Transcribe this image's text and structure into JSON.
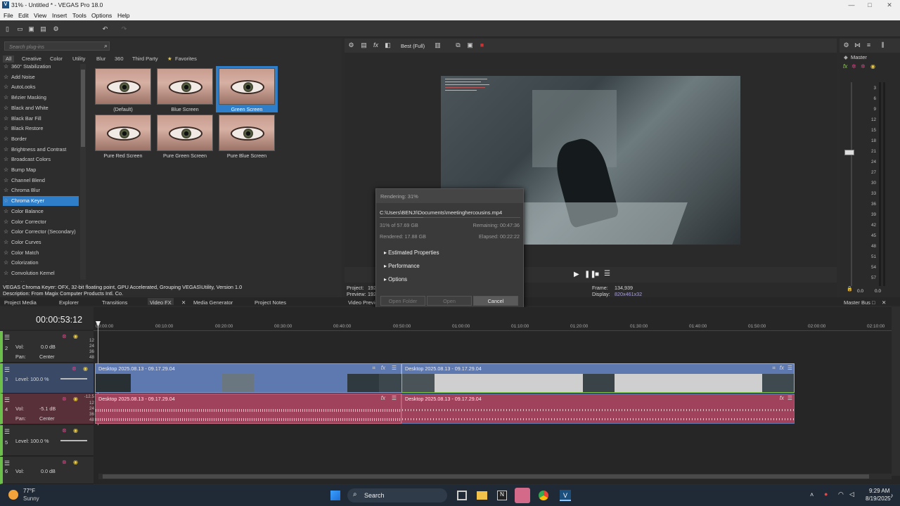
{
  "window": {
    "title": "31% - Untitled * - VEGAS Pro 18.0",
    "app_icon_letter": "V"
  },
  "menu": [
    "File",
    "Edit",
    "View",
    "Insert",
    "Tools",
    "Options",
    "Help"
  ],
  "plugins": {
    "search_placeholder": "Search plug-ins",
    "categories": [
      "All",
      "Creative",
      "Color",
      "Utility",
      "Blur",
      "360",
      "Third Party",
      "Favorites"
    ],
    "list": [
      "360° Stabilization",
      "Add Noise",
      "AutoLooks",
      "Bézier Masking",
      "Black and White",
      "Black Bar Fill",
      "Black Restore",
      "Border",
      "Brightness and Contrast",
      "Broadcast Colors",
      "Bump Map",
      "Channel Blend",
      "Chroma Blur",
      "Chroma Keyer",
      "Color Balance",
      "Color Corrector",
      "Color Corrector (Secondary)",
      "Color Curves",
      "Color Match",
      "Colorization",
      "Convolution Kernel",
      "Cookie Cutter"
    ],
    "selected": "Chroma Keyer",
    "presets": [
      "(Default)",
      "Blue Screen",
      "Green Screen",
      "Pure Red Screen",
      "Pure Green Screen",
      "Pure Blue Screen"
    ],
    "selected_preset": "Green Screen",
    "description_line1": "VEGAS Chroma Keyer: OFX, 32-bit floating point, GPU Accelerated, Grouping VEGAS\\Utility, Version 1.0",
    "description_line2": "Description: From Magix Computer Products Intl. Co."
  },
  "bottom_tabs": [
    "Project Media",
    "Explorer",
    "Transitions",
    "Video FX",
    "Media Generator",
    "Project Notes"
  ],
  "preview": {
    "quality": "Best (Full)",
    "project_label": "Project:",
    "project_value": "192",
    "preview_label": "Preview:",
    "preview_value": "192",
    "frame_label": "Frame:",
    "frame_value": "134,939",
    "display_label": "Display:",
    "display_value": "820x461x32",
    "tab": "Video Preview"
  },
  "master": {
    "label": "Master",
    "bus_tab": "Master Bus",
    "scale": [
      "3",
      "6",
      "9",
      "12",
      "15",
      "18",
      "21",
      "24",
      "27",
      "30",
      "33",
      "36",
      "39",
      "42",
      "45",
      "48",
      "51",
      "54",
      "57"
    ],
    "readout_left": "0.0",
    "readout_right": "0.0"
  },
  "render_dialog": {
    "header": "Rendering: 31%",
    "path": "C:\\Users\\BENJI\\Documents\\meetinghercousins.mp4",
    "progress_text": "31% of 57.69 GB",
    "remaining": "Remaining: 00:47:36",
    "rendered": "Rendered: 17.88 GB",
    "elapsed": "Elapsed: 00:22:22",
    "sections": [
      "Estimated Properties",
      "Performance",
      "Options"
    ],
    "open_folder": "Open Folder",
    "open": "Open",
    "cancel": "Cancel",
    "progress": 0.31
  },
  "timeline": {
    "timecode": "00:00:53:12",
    "ruler": [
      "00:00:00",
      "00:10:00",
      "00:20:00",
      "00:30:00",
      "00:40:00",
      "00:50:00",
      "01:00:00",
      "01:10:00",
      "01:20:00",
      "01:30:00",
      "01:40:00",
      "01:50:00",
      "02:00:00",
      "02:10:00"
    ],
    "tracks": [
      {
        "num": "2",
        "vol": "Vol:",
        "vol_value": "0.0 dB",
        "pan": "Pan:",
        "pan_value": "Center"
      },
      {
        "num": "3",
        "level": "Level: 100.0 %"
      },
      {
        "num": "4",
        "vol": "Vol:",
        "vol_value": "-5.1 dB",
        "pan": "Pan:",
        "pan_value": "Center"
      },
      {
        "num": "5",
        "level": "Level: 100.0 %"
      },
      {
        "num": "6",
        "vol": "Vol:",
        "vol_value": "0.0 dB"
      }
    ],
    "clip_name": "Desktop 2025.08.13 - 09.17.29.04",
    "meter_ticks": [
      "12",
      "24",
      "36",
      "48"
    ],
    "meter_ticks_audio": [
      "-12.5",
      "12",
      "24",
      "36",
      "48"
    ]
  },
  "taskbar": {
    "weather_temp": "77°F",
    "weather_desc": "Sunny",
    "search": "Search",
    "time": "9:29 AM",
    "date": "8/19/2025"
  },
  "colors": {
    "selection": "#2f7ec9",
    "video_track": "#5e78b0",
    "audio_track": "#a0425b",
    "accent_green": "#8fd14f"
  }
}
